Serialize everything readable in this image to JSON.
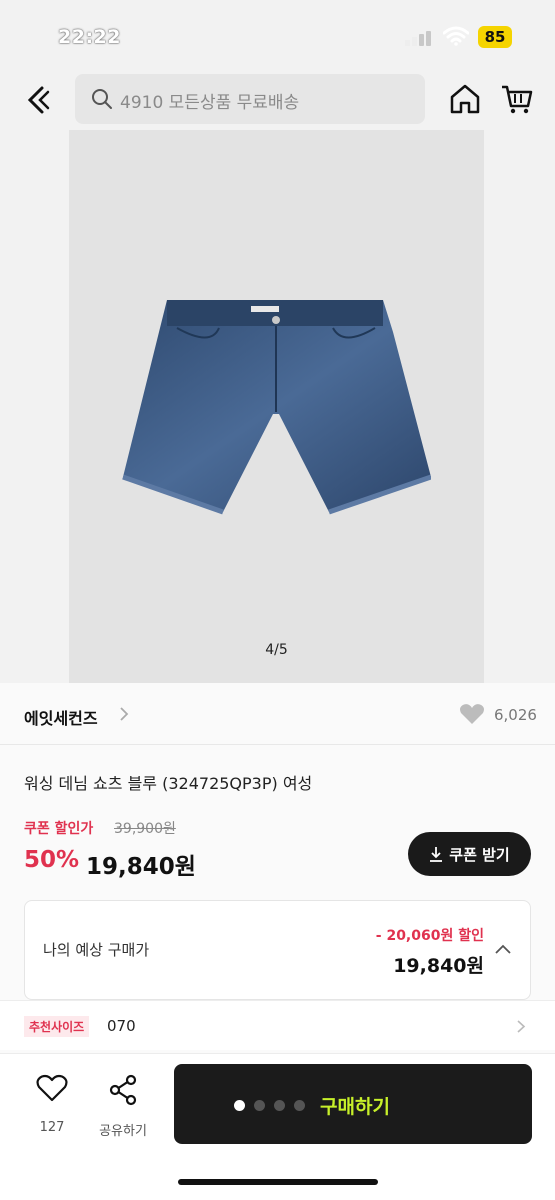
{
  "status": {
    "time": "22:22",
    "battery": "85"
  },
  "nav": {
    "search_placeholder": "4910 모든상품 무료배송"
  },
  "gallery": {
    "counter": "4/5"
  },
  "product": {
    "brand": "에잇세컨즈",
    "likes": "6,026",
    "title": "워싱 데님 쇼츠 블루 (324725QP3P) 여성",
    "coupon_label": "쿠폰 할인가",
    "original_price": "39,900원",
    "discount_rate": "50%",
    "sale_price": "19,840원",
    "coupon_button": "쿠폰 받기"
  },
  "expected": {
    "label": "나의 예상 구매가",
    "discount": "- 20,060원 할인",
    "price": "19,840원"
  },
  "size": {
    "tag": "추천사이즈",
    "value": "070"
  },
  "bottom": {
    "like_count": "127",
    "share_label": "공유하기",
    "buy_label": "구매하기"
  },
  "colors": {
    "accent_red": "#e0324f",
    "buy_text": "#c7f02a",
    "battery": "#f5d400"
  }
}
